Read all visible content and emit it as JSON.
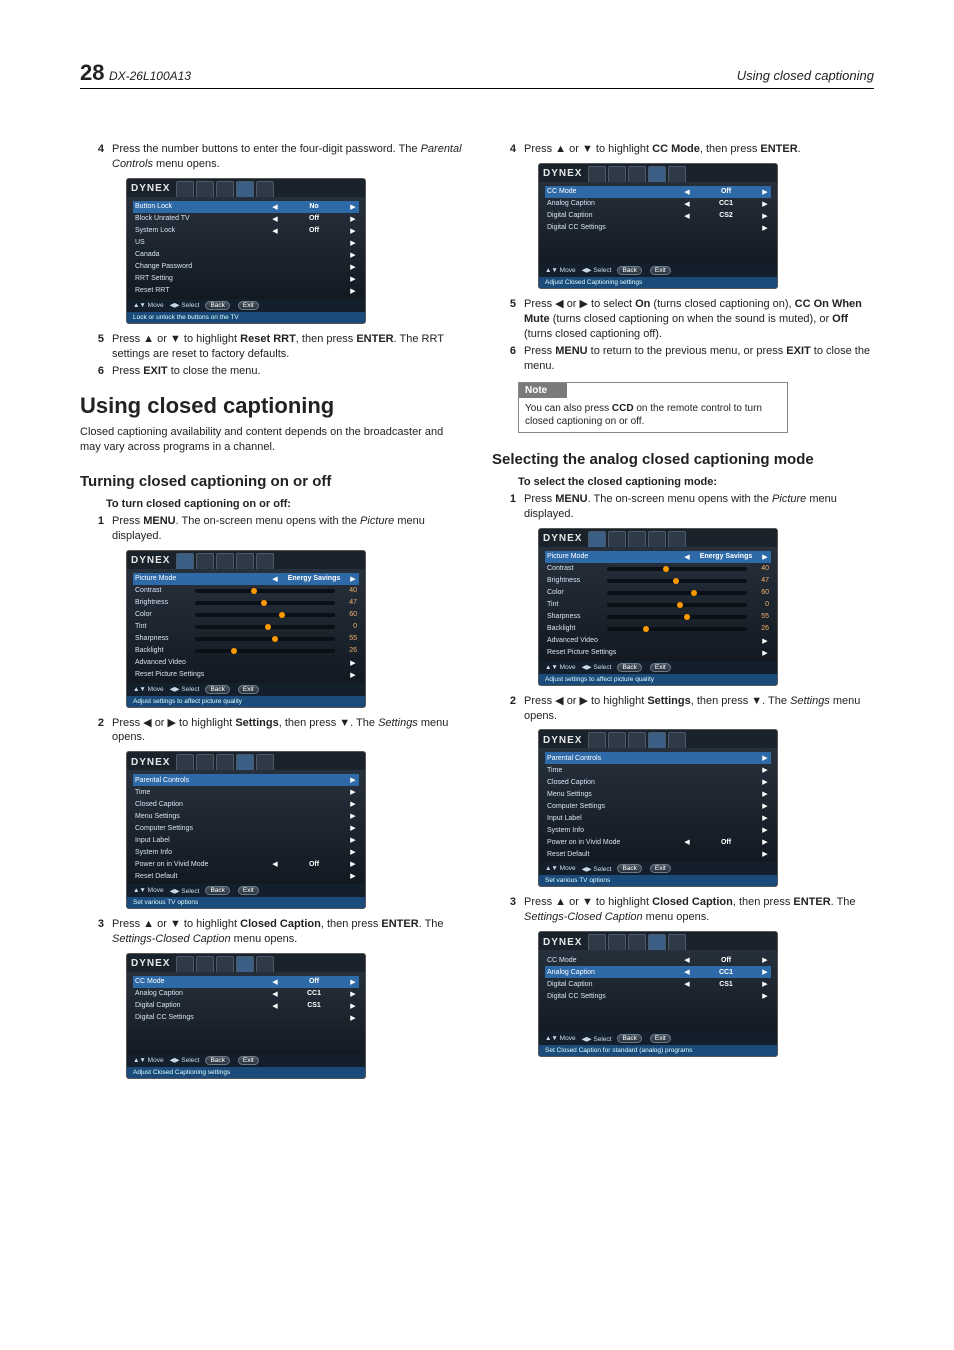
{
  "page": {
    "number": "28",
    "model": "DX-26L100A13",
    "header_right": "Using closed captioning"
  },
  "osd": {
    "logo": "DYNEX",
    "foot_move": "▲▼ Move",
    "foot_select": "◀▶ Select",
    "foot_back": "Back",
    "foot_exit": "Exit"
  },
  "left": {
    "step4": {
      "n": "4",
      "t1": "Press the number buttons to enter the four-digit password. The ",
      "t2": "Parental Controls",
      "t3": " menu opens."
    },
    "osd_parental": {
      "hint": "Lock or unlock the buttons on the TV",
      "rows": [
        {
          "label": "Button Lock",
          "val": "No",
          "hl": true,
          "arrows": true
        },
        {
          "label": "Block Unrated TV",
          "val": "Off",
          "arrows": true
        },
        {
          "label": "System Lock",
          "val": "Off",
          "arrows": true
        },
        {
          "label": "US",
          "r": true
        },
        {
          "label": "Canada",
          "r": true
        },
        {
          "label": "Change Password",
          "r": true
        },
        {
          "label": "RRT Setting",
          "r": true
        },
        {
          "label": "Reset RRT",
          "r": true
        }
      ]
    },
    "step5": {
      "n": "5",
      "t1": "Press ▲ or ▼ to highlight ",
      "b1": "Reset RRT",
      "t2": ", then press ",
      "b2": "ENTER",
      "t3": ". The RRT settings are reset to factory defaults."
    },
    "step6": {
      "n": "6",
      "t1": "Press ",
      "b1": "EXIT",
      "t2": " to close the menu."
    },
    "h1": "Using closed captioning",
    "intro": "Closed captioning availability and content depends on the broadcaster and may vary across programs in a channel.",
    "h2": "Turning closed captioning on or off",
    "task": "To turn closed captioning on or off:",
    "s1": {
      "n": "1",
      "t1": "Press ",
      "b1": "MENU",
      "t2": ". The on-screen menu opens with the ",
      "i1": "Picture",
      "t3": " menu displayed."
    },
    "s2": {
      "n": "2",
      "t1": "Press ◀ or ▶ to highlight ",
      "b1": "Settings",
      "t2": ", then press ▼. The ",
      "i1": "Settings",
      "t3": " menu opens."
    },
    "s3": {
      "n": "3",
      "t1": "Press ▲ or ▼ to highlight ",
      "b1": "Closed Caption",
      "t2": ", then press ",
      "b2": "ENTER",
      "t3": ". The ",
      "i1": "Settings-Closed Caption",
      "t4": " menu opens."
    },
    "osd_picture": {
      "hint": "Adjust settings to affect picture quality",
      "mode_label": "Picture Mode",
      "mode_val": "Energy Savings",
      "sliders": [
        {
          "label": "Contrast",
          "val": "40",
          "pos": "40%"
        },
        {
          "label": "Brightness",
          "val": "47",
          "pos": "47%"
        },
        {
          "label": "Color",
          "val": "60",
          "pos": "60%"
        },
        {
          "label": "Tint",
          "val": "0",
          "pos": "50%"
        },
        {
          "label": "Sharpness",
          "val": "55",
          "pos": "55%"
        },
        {
          "label": "Backlight",
          "val": "26",
          "pos": "26%"
        }
      ],
      "extra": [
        "Advanced Video",
        "Reset Picture Settings"
      ]
    },
    "osd_settings": {
      "hint": "Set various TV options",
      "rows": [
        {
          "label": "Parental Controls",
          "r": true,
          "hl": true
        },
        {
          "label": "Time",
          "r": true
        },
        {
          "label": "Closed Caption",
          "r": true
        },
        {
          "label": "Menu Settings",
          "r": true
        },
        {
          "label": "Computer Settings",
          "r": true
        },
        {
          "label": "Input Label",
          "r": true
        },
        {
          "label": "System Info",
          "r": true
        },
        {
          "label": "Power on in Vivid Mode",
          "val": "Off",
          "arrows": true
        },
        {
          "label": "Reset Default",
          "r": true
        }
      ]
    },
    "osd_cc": {
      "hint": "Adjust Closed Captioning settings",
      "rows": [
        {
          "label": "CC Mode",
          "val": "Off",
          "hl": true,
          "arrows": true
        },
        {
          "label": "Analog Caption",
          "val": "CC1",
          "arrows": true
        },
        {
          "label": "Digital Caption",
          "val": "CS1",
          "arrows": true
        },
        {
          "label": "Digital CC Settings",
          "r": true
        }
      ]
    }
  },
  "right": {
    "step4": {
      "n": "4",
      "t1": "Press ▲ or ▼ to highlight ",
      "b1": "CC Mode",
      "t2": ", then press ",
      "b2": "ENTER",
      "t3": "."
    },
    "osd_cc": {
      "hint": "Adjust Closed Captioning settings",
      "rows": [
        {
          "label": "CC Mode",
          "val": "Off",
          "hl": true,
          "arrows": true
        },
        {
          "label": "Analog Caption",
          "val": "CC1",
          "arrows": true
        },
        {
          "label": "Digital Caption",
          "val": "CS2",
          "arrows": true
        },
        {
          "label": "Digital CC Settings",
          "r": true
        }
      ]
    },
    "step5": {
      "n": "5",
      "t1": "Press ◀ or ▶ to select ",
      "b1": "On",
      "t2": " (turns closed captioning on), ",
      "b2": "CC On When Mute",
      "t3": " (turns closed captioning on when the sound is muted), or ",
      "b3": "Off",
      "t4": " (turns closed captioning off)."
    },
    "step6": {
      "n": "6",
      "t1": "Press ",
      "b1": "MENU",
      "t2": " to return to the previous menu, or press ",
      "b2": "EXIT",
      "t3": " to close the menu."
    },
    "note": {
      "head": "Note",
      "t1": "You can also press ",
      "b1": "CCD",
      "t2": " on the remote control to turn closed captioning on or off."
    },
    "h2": "Selecting the analog closed captioning mode",
    "task": "To select the closed captioning mode:",
    "s1": {
      "n": "1",
      "t1": "Press ",
      "b1": "MENU",
      "t2": ". The on-screen menu opens with the ",
      "i1": "Picture",
      "t3": " menu displayed."
    },
    "s2": {
      "n": "2",
      "t1": "Press ◀ or ▶ to highlight ",
      "b1": "Settings",
      "t2": ", then press ▼. The ",
      "i1": "Settings",
      "t3": " menu opens."
    },
    "s3": {
      "n": "3",
      "t1": "Press ▲ or ▼ to highlight ",
      "b1": "Closed Caption",
      "t2": ", then press ",
      "b2": "ENTER",
      "t3": ". The ",
      "i1": "Settings-Closed Caption",
      "t4": " menu opens."
    },
    "osd_cc_analog": {
      "hint": "Set Closed Caption for standard (analog) programs",
      "rows": [
        {
          "label": "CC Mode",
          "val": "Off",
          "arrows": true
        },
        {
          "label": "Analog Caption",
          "val": "CC1",
          "hl": true,
          "arrows": true
        },
        {
          "label": "Digital Caption",
          "val": "CS1",
          "arrows": true
        },
        {
          "label": "Digital CC Settings",
          "r": true
        }
      ]
    }
  }
}
